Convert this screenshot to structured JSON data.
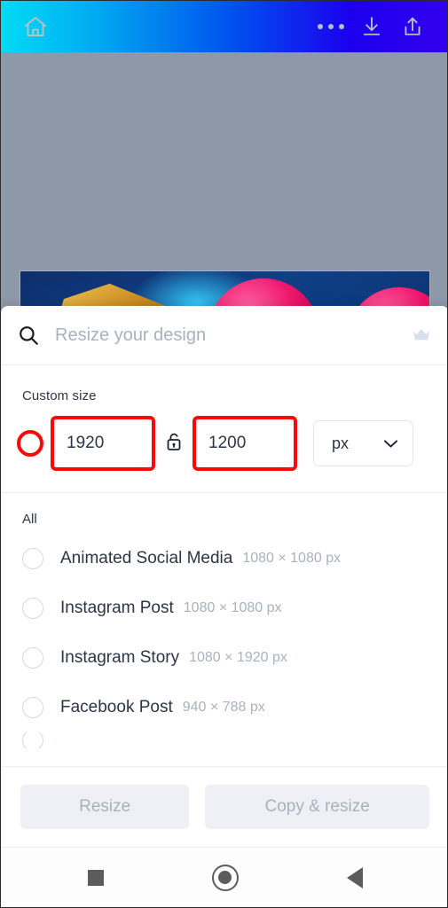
{
  "appbar": {
    "home_icon": "home-icon",
    "more_icon": "more-options-icon",
    "download_icon": "download-icon",
    "share_icon": "share-icon",
    "gradient_start": "#00dcf5",
    "gradient_end": "#3300ee"
  },
  "canvas": {
    "background_color": "#8d99a9"
  },
  "search": {
    "placeholder": "Resize your design",
    "value": "",
    "icon": "search-icon",
    "premium_icon": "crown-icon"
  },
  "custom_size": {
    "title": "Custom size",
    "width_value": "1920",
    "height_value": "1200",
    "lock_icon": "unlocked-padlock-icon",
    "unit": "px",
    "unit_chevron": "chevron-down-icon",
    "annotation_color": "#fb0a05",
    "selected": true
  },
  "list": {
    "header": "All",
    "items": [
      {
        "label": "Animated Social Media",
        "dimensions": "1080 × 1080 px",
        "selected": false
      },
      {
        "label": "Instagram Post",
        "dimensions": "1080 × 1080 px",
        "selected": false
      },
      {
        "label": "Instagram Story",
        "dimensions": "1080 × 1920 px",
        "selected": false
      },
      {
        "label": "Facebook Post",
        "dimensions": "940 × 788 px",
        "selected": false
      }
    ]
  },
  "footer": {
    "resize_label": "Resize",
    "copy_resize_label": "Copy & resize",
    "disabled": true
  },
  "navbar": {
    "recents_icon": "recents-square-icon",
    "home_icon": "home-circle-icon",
    "back_icon": "back-triangle-icon"
  }
}
